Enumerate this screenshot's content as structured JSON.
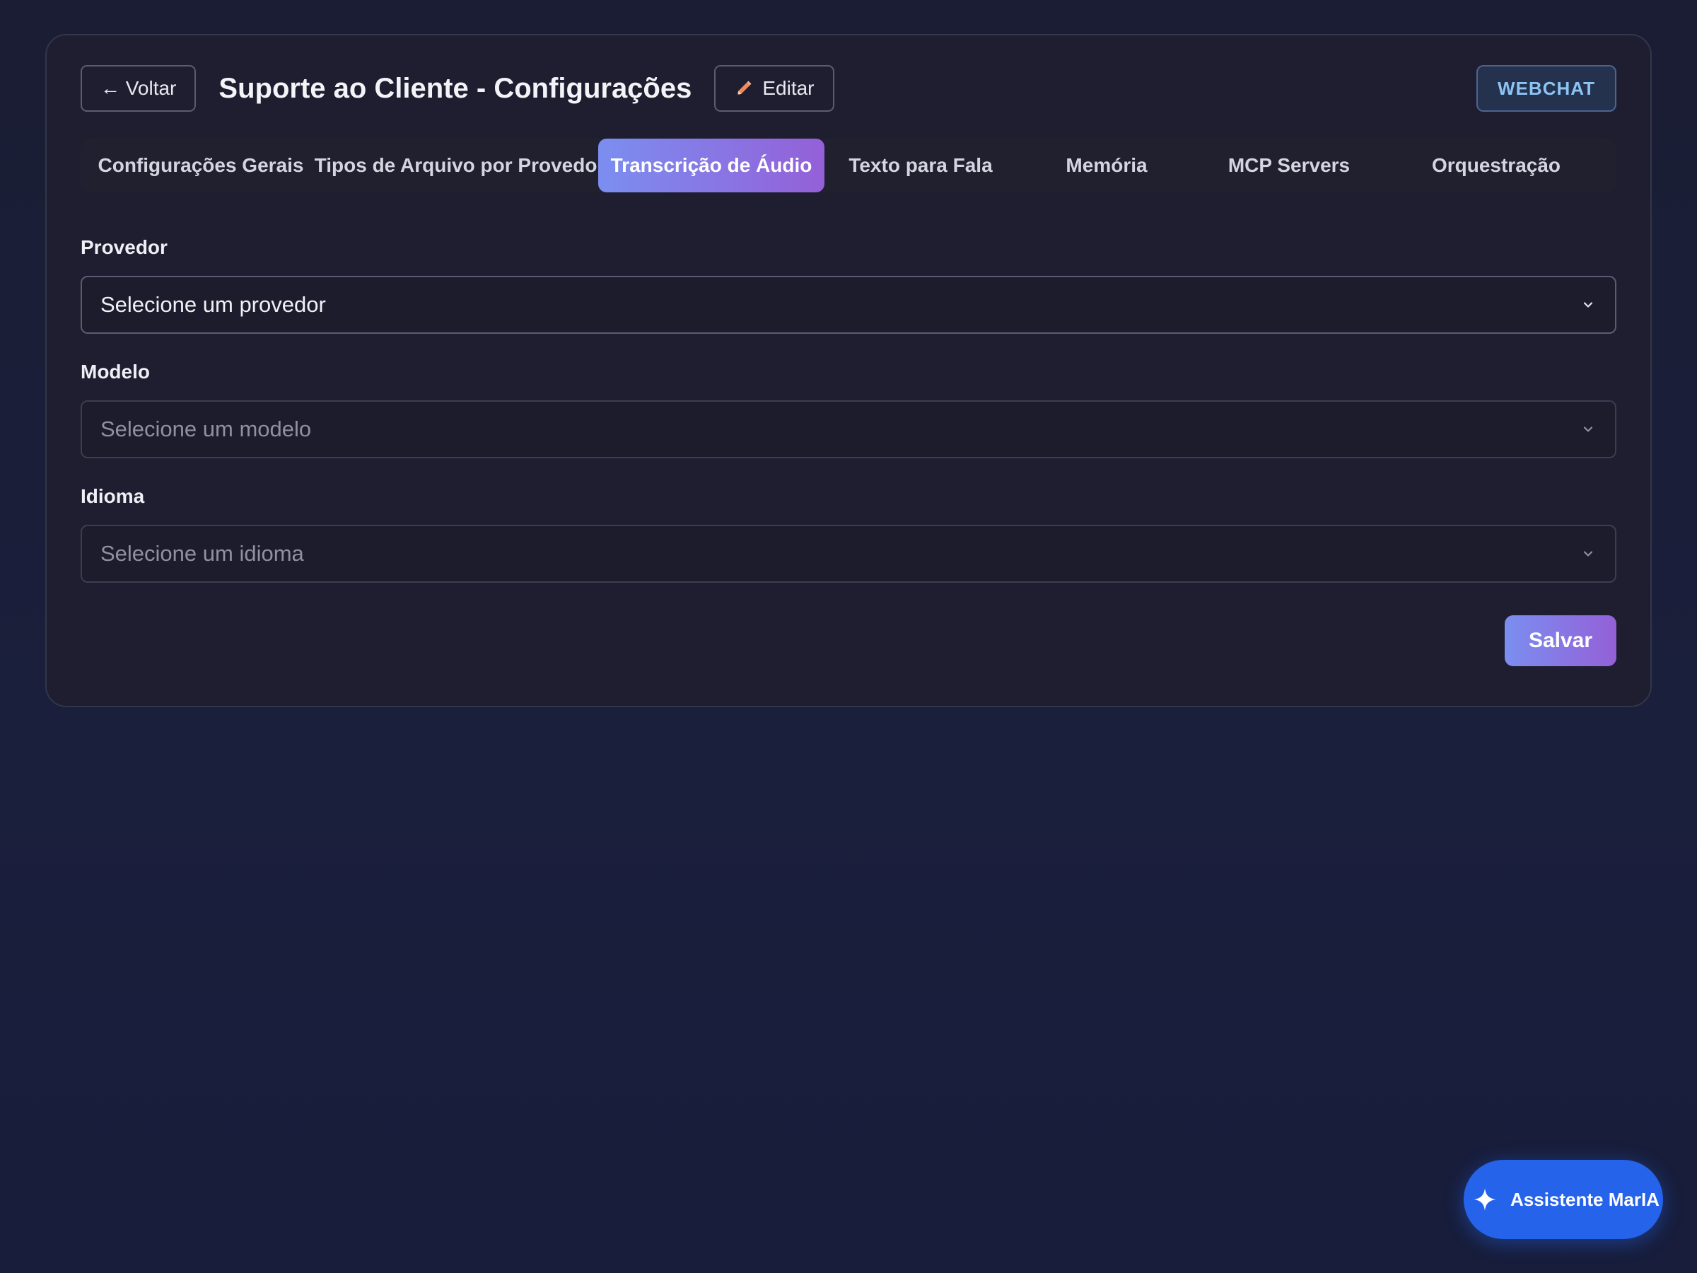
{
  "header": {
    "back_label": "← Voltar",
    "title": "Suporte ao Cliente - Configurações",
    "edit_label": "Editar",
    "channel_badge": "WEBCHAT"
  },
  "tabs": [
    {
      "label": "Configurações Gerais",
      "active": false
    },
    {
      "label": "Tipos de Arquivo por Provedor",
      "active": false
    },
    {
      "label": "Transcrição de Áudio",
      "active": true
    },
    {
      "label": "Texto para Fala",
      "active": false
    },
    {
      "label": "Memória",
      "active": false
    },
    {
      "label": "MCP Servers",
      "active": false
    },
    {
      "label": "Orquestração",
      "active": false
    }
  ],
  "form": {
    "provider": {
      "label": "Provedor",
      "value": "Selecione um provedor",
      "enabled": true
    },
    "model": {
      "label": "Modelo",
      "value": "Selecione um modelo",
      "enabled": false
    },
    "language": {
      "label": "Idioma",
      "value": "Selecione um idioma",
      "enabled": false
    },
    "save_label": "Salvar"
  },
  "assistant": {
    "label": "Assistente MarIA",
    "icon": "sparkle-icon"
  },
  "colors": {
    "accent_gradient_start": "#7b8ef0",
    "accent_gradient_end": "#9460d8",
    "assistant_blue": "#2563eb",
    "badge_text": "#8cc4f4"
  }
}
